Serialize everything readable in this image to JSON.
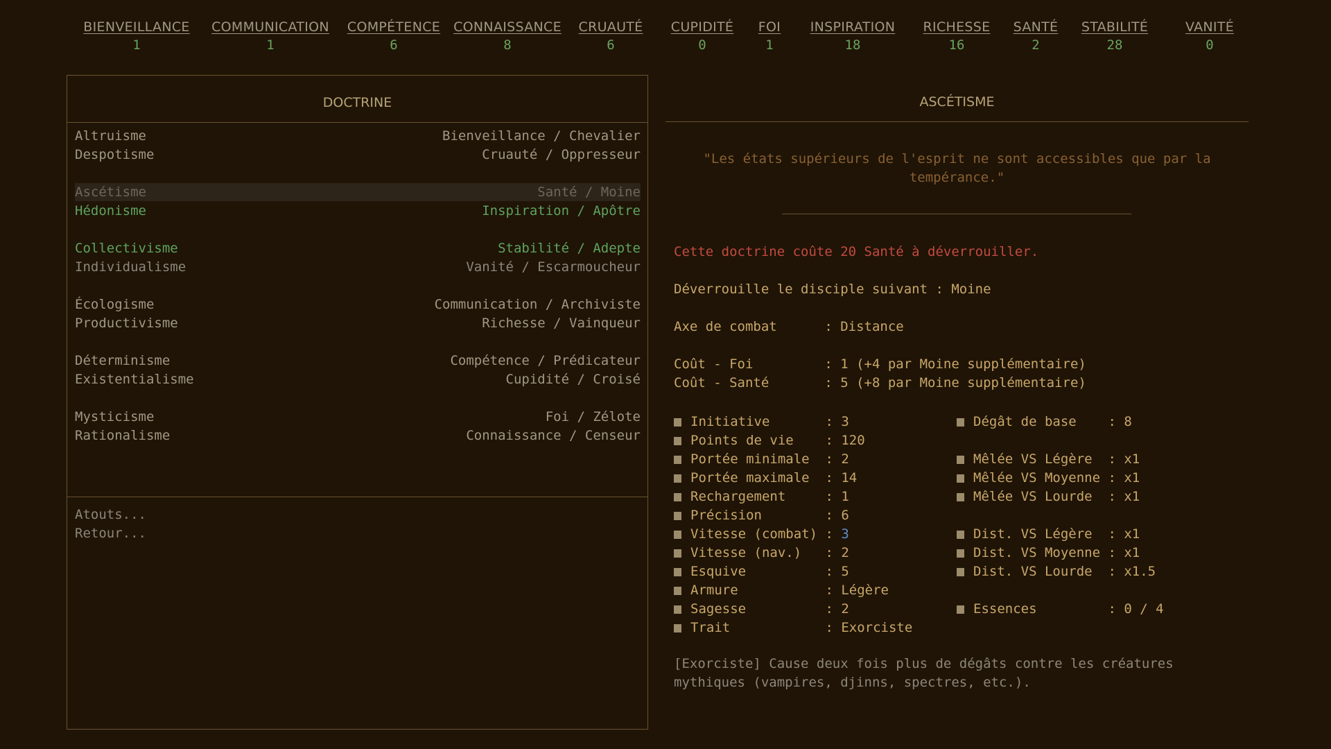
{
  "resources": [
    {
      "name": "BIENVEILLANCE",
      "value": "1"
    },
    {
      "name": "COMMUNICATION",
      "value": "1"
    },
    {
      "name": "COMPÉTENCE",
      "value": "6"
    },
    {
      "name": "CONNAISSANCE",
      "value": "8"
    },
    {
      "name": "CRUAUTÉ",
      "value": "6"
    },
    {
      "name": "CUPIDITÉ",
      "value": "0"
    },
    {
      "name": "FOI",
      "value": "1"
    },
    {
      "name": "INSPIRATION",
      "value": "18"
    },
    {
      "name": "RICHESSE",
      "value": "16"
    },
    {
      "name": "SANTÉ",
      "value": "2"
    },
    {
      "name": "STABILITÉ",
      "value": "28"
    },
    {
      "name": "VANITÉ",
      "value": "0"
    }
  ],
  "left_panel": {
    "title": "DOCTRINE",
    "doctrines": [
      {
        "name": "Altruisme",
        "path": "Bienveillance / Chevalier",
        "state": "normal"
      },
      {
        "name": "Despotisme",
        "path": "Cruauté / Oppresseur",
        "state": "normal"
      },
      {
        "name": "Ascétisme",
        "path": "Santé / Moine",
        "state": "selected"
      },
      {
        "name": "Hédonisme",
        "path": "Inspiration / Apôtre",
        "state": "green"
      },
      {
        "name": "Collectivisme",
        "path": "Stabilité / Adepte",
        "state": "green"
      },
      {
        "name": "Individualisme",
        "path": "Vanité / Escarmoucheur",
        "state": "gray"
      },
      {
        "name": "Écologisme",
        "path": "Communication / Archiviste",
        "state": "normal"
      },
      {
        "name": "Productivisme",
        "path": "Richesse / Vainqueur",
        "state": "normal"
      },
      {
        "name": "Déterminisme",
        "path": "Compétence / Prédicateur",
        "state": "normal"
      },
      {
        "name": "Existentialisme",
        "path": "Cupidité / Croisé",
        "state": "normal"
      },
      {
        "name": "Mysticisme",
        "path": "Foi / Zélote",
        "state": "normal"
      },
      {
        "name": "Rationalisme",
        "path": "Connaissance / Censeur",
        "state": "normal"
      }
    ],
    "menu": {
      "perks": "Atouts...",
      "back": "Retour..."
    }
  },
  "right_panel": {
    "title": "ASCÉTISME",
    "quote": "\"Les états supérieurs de l'esprit ne sont accessibles que par la tempérance.\"",
    "unlock_cost": "Cette doctrine coûte 20 Santé à déverrouiller.",
    "unlocks": "Déverrouille le disciple suivant : Moine",
    "combat_axis": "Axe de combat      : Distance",
    "cost_faith": "Coût - Foi         : 1 (+4 par Moine supplémentaire)",
    "cost_health": "Coût - Santé       : 5 (+8 par Moine supplémentaire)",
    "stats_left": [
      {
        "label": "Initiative       ",
        "value": "3"
      },
      {
        "label": "Points de vie    ",
        "value": "120"
      },
      {
        "label": "Portée minimale  ",
        "value": "2"
      },
      {
        "label": "Portée maximale  ",
        "value": "14"
      },
      {
        "label": "Rechargement     ",
        "value": "1"
      },
      {
        "label": "Précision        ",
        "value": "6"
      },
      {
        "label": "Vitesse (combat) ",
        "value": "3"
      },
      {
        "label": "Vitesse (nav.)   ",
        "value": "2"
      },
      {
        "label": "Esquive          ",
        "value": "5"
      },
      {
        "label": "Armure           ",
        "value": "Légère"
      },
      {
        "label": "Sagesse          ",
        "value": "2"
      },
      {
        "label": "Trait            ",
        "value": "Exorciste"
      }
    ],
    "stats_right": [
      {
        "row": 0,
        "label": "Dégât de base    ",
        "value": "8"
      },
      {
        "row": 2,
        "label": "Mêlée VS Légère  ",
        "value": "x1"
      },
      {
        "row": 3,
        "label": "Mêlée VS Moyenne ",
        "value": "x1"
      },
      {
        "row": 4,
        "label": "Mêlée VS Lourde  ",
        "value": "x1"
      },
      {
        "row": 6,
        "label": "Dist. VS Légère  ",
        "value": "x1"
      },
      {
        "row": 7,
        "label": "Dist. VS Moyenne ",
        "value": "x1"
      },
      {
        "row": 8,
        "label": "Dist. VS Lourde  ",
        "value": "x1.5"
      },
      {
        "row": 10,
        "label": "Essences         ",
        "value": "0 / 4"
      }
    ],
    "trait_description": "[Exorciste] Cause deux fois plus de dégâts contre les créatures mythiques (vampires, djinns, spectres, etc.).",
    "colors": {
      "green": "#5fa35e",
      "red": "#c44a40",
      "gold": "#c9a76a",
      "blue": "#5d8fcb"
    }
  }
}
